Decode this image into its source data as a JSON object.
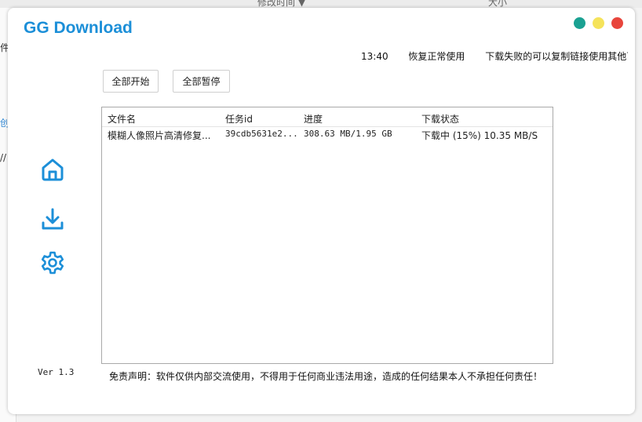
{
  "background_app": {
    "column_modified": "修改时间 ▼",
    "column_size": "大小",
    "left_fragments": [
      "件",
      "创",
      "//"
    ]
  },
  "app": {
    "title": "GG Download",
    "window_controls": [
      {
        "name": "teal-control",
        "color": "#1aa192"
      },
      {
        "name": "yellow-control",
        "color": "#f5e35a"
      },
      {
        "name": "red-control",
        "color": "#e8453c"
      }
    ]
  },
  "notice": {
    "time": "13:40",
    "message1": "恢复正常使用",
    "message2": "下载失败的可以复制链接使用其他下载"
  },
  "toolbar": {
    "start_all": "全部开始",
    "pause_all": "全部暂停"
  },
  "table": {
    "headers": {
      "filename": "文件名",
      "task_id": "任务id",
      "progress": "进度",
      "status": "下载状态"
    },
    "rows": [
      {
        "filename": "模糊人像照片高清修复...",
        "task_id": "39cdb5631e2...",
        "progress": "308.63 MB/1.95 GB",
        "status": "下载中 (15%) 10.35 MB/S"
      }
    ]
  },
  "sidebar": {
    "icons": [
      "home-icon",
      "download-icon",
      "settings-icon"
    ],
    "accent": "#1c8fd8"
  },
  "footer": {
    "version": "Ver 1.3",
    "disclaimer": "免责声明：软件仅供内部交流使用，不得用于任何商业违法用途，造成的任何结果本人不承担任何责任！"
  }
}
